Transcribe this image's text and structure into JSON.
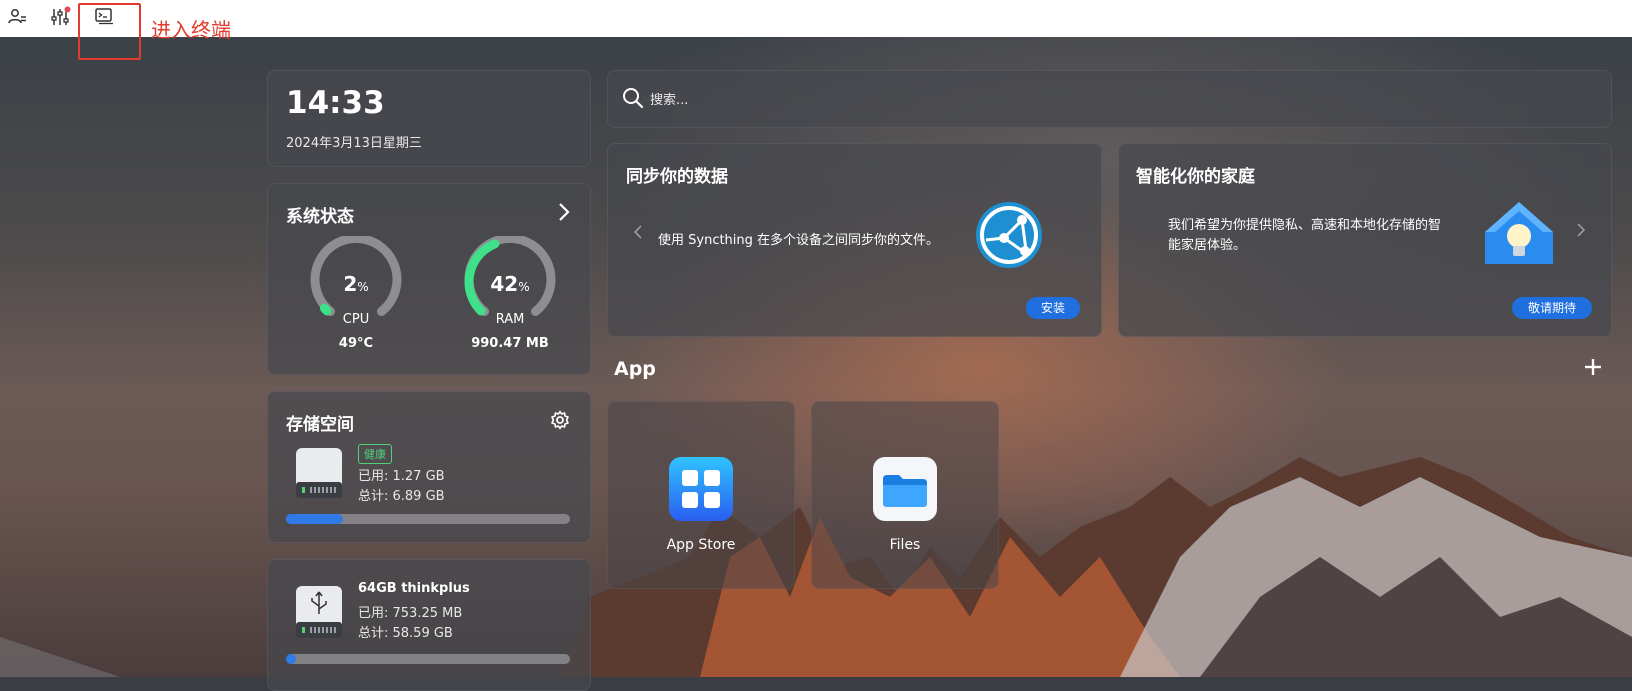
{
  "annotation": {
    "text": "进入终端"
  },
  "clock": {
    "time": "14:33",
    "date": "2024年3月13日星期三"
  },
  "system_status": {
    "title": "系统状态",
    "cpu": {
      "value": "2",
      "unit": "%",
      "label": "CPU",
      "temp": "49°C",
      "percent": 2
    },
    "ram": {
      "value": "42",
      "unit": "%",
      "label": "RAM",
      "usage": "990.47 MB",
      "percent": 42
    }
  },
  "storage": {
    "title": "存储空间",
    "disk": {
      "badge": "健康",
      "used": "已用: 1.27 GB",
      "total": "总计: 6.89 GB",
      "fill_fraction": 0.2
    },
    "usb": {
      "name": "64GB thinkplus",
      "used": "已用: 753.25 MB",
      "total": "总计: 58.59 GB",
      "fill_fraction": 0.01
    }
  },
  "search": {
    "placeholder": "搜索..."
  },
  "promo_sync": {
    "title": "同步你的数据",
    "desc": "使用 Syncthing 在多个设备之间同步你的文件。",
    "button": "安装"
  },
  "promo_home": {
    "title": "智能化你的家庭",
    "desc_line1": "我们希望为你提供隐私、高速和本地化存储的智",
    "desc_line2": "能家居体验。",
    "button": "敬请期待"
  },
  "apps": {
    "title": "App",
    "items": [
      {
        "label": "App Store"
      },
      {
        "label": "Files"
      }
    ]
  },
  "colors": {
    "accent": "#1f6fe0",
    "gauge_green": "#3ee08a",
    "annotation_red": "#e23a2b"
  }
}
